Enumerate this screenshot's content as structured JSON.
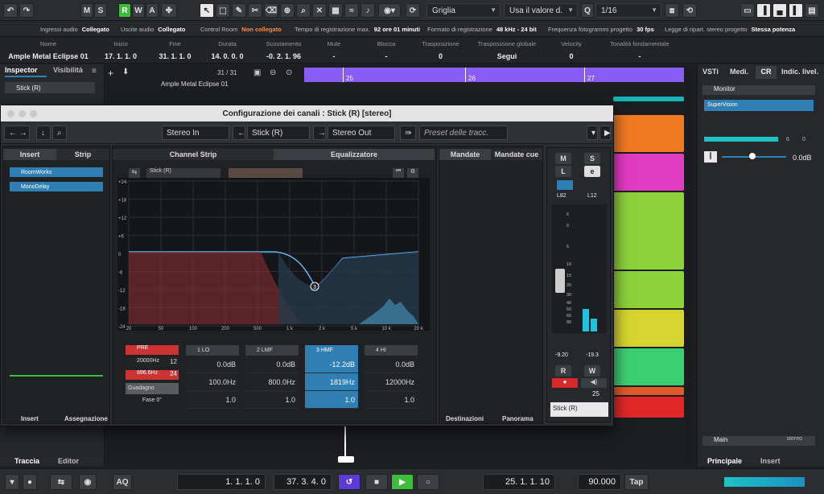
{
  "toolbar": {
    "modes": [
      "M",
      "S",
      "R",
      "W",
      "A"
    ],
    "snap_type": "Griglia",
    "quantize_use": "Usa il valore d.",
    "quantize_value": "1/16",
    "quantize_prefix": "Q"
  },
  "status": [
    {
      "label": "Ingressi audio",
      "value": "Collegato"
    },
    {
      "label": "Uscite audio",
      "value": "Collegato"
    },
    {
      "label": "Control Room",
      "value": "Non collegato"
    },
    {
      "label": "Tempo di registrazione max.",
      "value": "92 ore 01 minuti"
    },
    {
      "label": "Formato di registrazione",
      "value": "48 kHz - 24 bit"
    },
    {
      "label": "Frequenza fotogrammi progetto",
      "value": "30 fps"
    },
    {
      "label": "Legge di ripart. stereo progetto",
      "value": "Stessa potenza"
    }
  ],
  "infoline": {
    "track_name": "Ample Metal Eclipse 01",
    "columns": [
      {
        "label": "Nome",
        "value": "Ample Metal Eclipse 01"
      },
      {
        "label": "Inizio",
        "value": "17. 1. 1.   0"
      },
      {
        "label": "Fine",
        "value": "31. 1. 1.   0"
      },
      {
        "label": "Durata",
        "value": "14. 0. 0.   0"
      },
      {
        "label": "Scostamento",
        "value": "-0. 2. 1.  96"
      },
      {
        "label": "Mute",
        "value": "-"
      },
      {
        "label": "Blocca",
        "value": "-"
      },
      {
        "label": "Trasposizione",
        "value": "0"
      },
      {
        "label": "Trasposizione globale",
        "value": "Segui"
      },
      {
        "label": "Velocity",
        "value": "0"
      },
      {
        "label": "Tonalità fondamentale",
        "value": "-"
      }
    ]
  },
  "left": {
    "tab_inspector": "Inspector",
    "tab_visibility": "Visibilità",
    "track": "Stick (R)",
    "bottom_tab1": "Traccia",
    "bottom_tab2": "Editor"
  },
  "project": {
    "counter": "31 / 31",
    "track_label": "Ample Metal Eclipse 01",
    "ruler": [
      "25",
      "26",
      "27"
    ]
  },
  "right": {
    "tabs": [
      "VSTi",
      "Medi.",
      "CR",
      "Indic. livel."
    ],
    "monitor": "Monitor",
    "supervision": "SuperVision",
    "meter_values": [
      "6",
      "0"
    ],
    "level": "0.0dB",
    "main": "Main",
    "main_fmt": "stereo",
    "bottom_tab1": "Principale",
    "bottom_tab2": "Insert"
  },
  "mixer": {
    "title": "Configurazione dei canali : Stick (R) [stereo]",
    "input": "Stereo In",
    "channel": "Stick (R)",
    "output": "Stereo Out",
    "preset": "Preset delle tracc.",
    "tab_insert": "Insert",
    "tab_strip": "Strip",
    "tab_channel_strip": "Channel Strip",
    "tab_eq": "Equalizzatore",
    "tab_sends": "Mandate",
    "tab_cue": "Mandate cue",
    "inserts": [
      "RoomWorks",
      "MonoDelay"
    ],
    "bottom_insert": "Insert",
    "bottom_assign": "Assegnazione",
    "bottom_dest": "Destinazioni",
    "bottom_pan": "Panorama",
    "eq_channel": "Stick (R)",
    "y_ticks": [
      "+24",
      "+18",
      "+12",
      "+6",
      "0",
      "-6",
      "-12",
      "-18",
      "-24"
    ],
    "x_ticks": [
      "20",
      "50",
      "100",
      "200",
      "500",
      "1 k",
      "2 k",
      "5 k",
      "10 k",
      "20 k"
    ],
    "pre": {
      "label": "PRE",
      "hp": "20000Hz",
      "hp_slope": "12",
      "lp": "896.6Hz",
      "lp_slope": "24",
      "gain_label": "Guadagno",
      "phase": "Fase 0°"
    },
    "bands": [
      {
        "name": "1 LO",
        "gain": "0.0dB",
        "freq": "100.0Hz",
        "q": "1.0"
      },
      {
        "name": "2 LMF",
        "gain": "0.0dB",
        "freq": "800.0Hz",
        "q": "1.0"
      },
      {
        "name": "3 HMF",
        "gain": "-12.2dB",
        "freq": "1819Hz",
        "q": "1.0"
      },
      {
        "name": "4 HI",
        "gain": "0.0dB",
        "freq": "12000Hz",
        "q": "1.0"
      }
    ],
    "fader": {
      "m": "M",
      "s": "S",
      "l": "L",
      "e": "e",
      "pan_l": "L82",
      "pan_r": "L12",
      "scale": [
        "6",
        "0",
        "5",
        "10",
        "15",
        "20",
        "30",
        "40",
        "50",
        "60",
        "80"
      ],
      "peak_l": "-9.20",
      "peak_r": "-19.3",
      "r": "R",
      "w": "W",
      "num": "25",
      "name": "Stick (R)"
    }
  },
  "transport": {
    "aq": "AQ",
    "left_locator": "1.   1.   1.     0",
    "right_locator": "37.  3.  4.     0",
    "position": "25.   1.   1.   10",
    "tempo": "90.000",
    "tap": "Tap"
  },
  "colors": {
    "accent": "#2f7fb4",
    "ruler": "#8a5cf6",
    "record": "#d42a2a",
    "play": "#3bbf3b",
    "not_connected": "#ff8c3a"
  }
}
